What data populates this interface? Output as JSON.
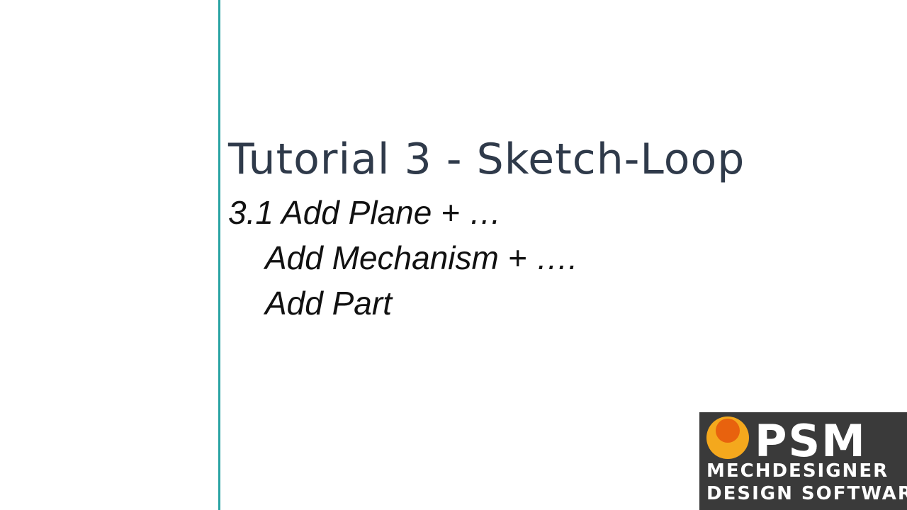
{
  "slide": {
    "title": "Tutorial 3 - Sketch-Loop",
    "lines": [
      "3.1 Add Plane + …",
      "Add Mechanism + ….",
      "Add Part"
    ]
  },
  "logo": {
    "brand": "PSM",
    "line1": "MECHDESIGNER",
    "line2": "DESIGN SOFTWARE",
    "colors": {
      "background": "#3a3a3a",
      "circle_outer": "#f4a81d",
      "circle_inner": "#e8620e",
      "text": "#ffffff"
    }
  },
  "accent_line_color": "#2aa3a3"
}
